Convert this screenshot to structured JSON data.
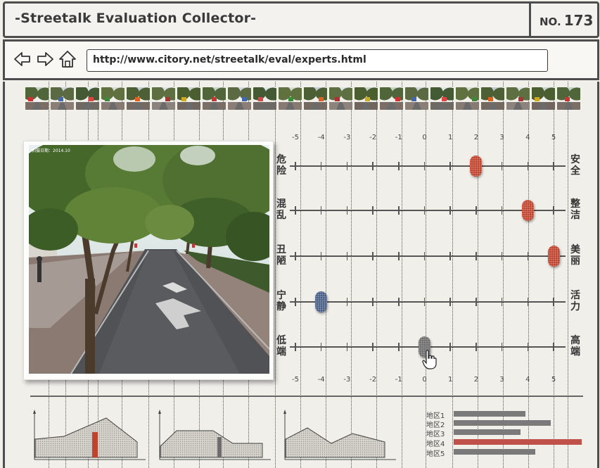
{
  "header": {
    "title": "-Streetalk Evaluation Collector-",
    "no_label": "NO.",
    "no_value": "173"
  },
  "nav": {
    "url": "http://www.citory.net/streetalk/eval/experts.html",
    "back_icon": "back-arrow-icon",
    "forward_icon": "forward-arrow-icon",
    "home_icon": "home-icon"
  },
  "photo": {
    "date_stamp": "拍摄日期：2014.10"
  },
  "scale": {
    "ticks": [
      "-5",
      "-4",
      "-3",
      "-2",
      "-1",
      "0",
      "1",
      "2",
      "3",
      "4",
      "5"
    ],
    "min": -5,
    "max": 5
  },
  "sliders": [
    {
      "left": "危险",
      "right": "安全",
      "value": 2,
      "color": "#c0432e"
    },
    {
      "left": "混乱",
      "right": "整洁",
      "value": 4,
      "color": "#c0432e"
    },
    {
      "left": "丑陋",
      "right": "美丽",
      "value": 5,
      "color": "#c0432e"
    },
    {
      "left": "宁静",
      "right": "活力",
      "value": -4,
      "color": "#4a5f86"
    },
    {
      "left": "低端",
      "right": "高端",
      "value": 0,
      "color": "#6d6d6d"
    }
  ],
  "regions": {
    "labels": [
      "地区1",
      "地区2",
      "地区3",
      "地区4",
      "地区5"
    ],
    "values": [
      0.56,
      0.76,
      0.52,
      1.0,
      0.64
    ],
    "highlight_index": 3,
    "bar_color": "#7a7a7a",
    "highlight_color": "#c0504a"
  },
  "colors": {
    "accent": "#c0432e",
    "frame": "#4d4d4d",
    "background": "#f1efea"
  }
}
